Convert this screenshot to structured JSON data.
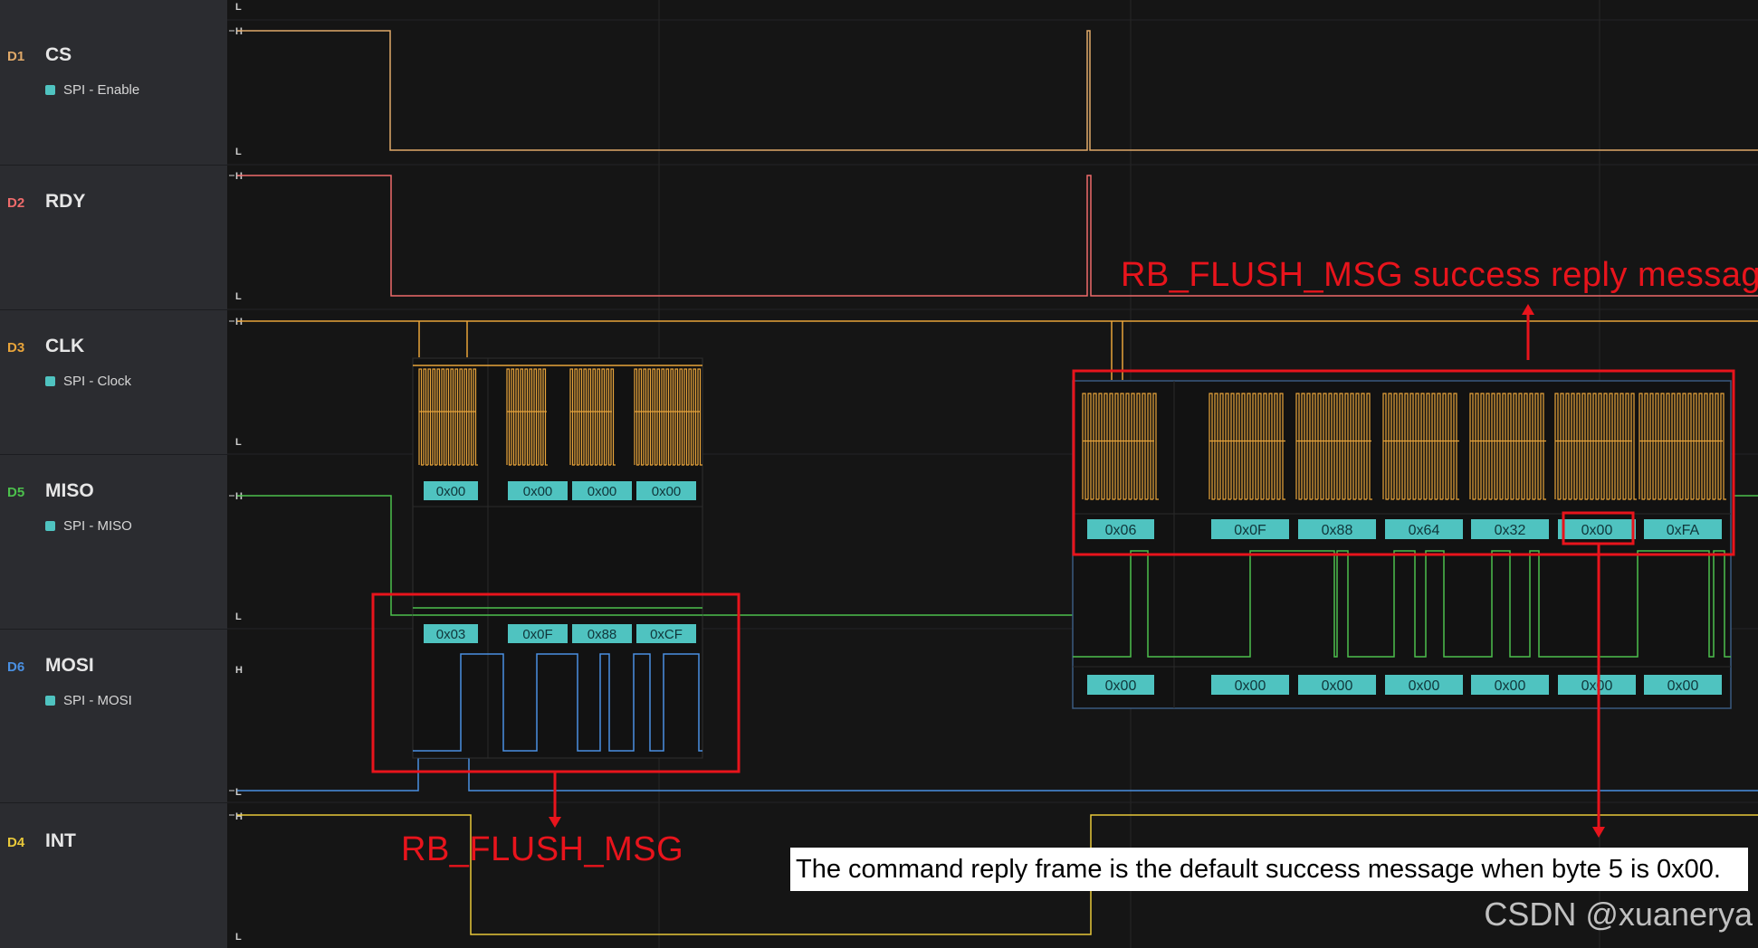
{
  "channels": [
    {
      "id": "D1",
      "name": "CS",
      "sub": "SPI - Enable",
      "color": "#e0a969"
    },
    {
      "id": "D2",
      "name": "RDY",
      "sub": "",
      "color": "#ee6b6b"
    },
    {
      "id": "D3",
      "name": "CLK",
      "sub": "SPI - Clock",
      "color": "#e8a43a"
    },
    {
      "id": "D5",
      "name": "MISO",
      "sub": "SPI - MISO",
      "color": "#4cc04c"
    },
    {
      "id": "D6",
      "name": "MOSI",
      "sub": "SPI - MOSI",
      "color": "#4a90e2"
    },
    {
      "id": "D4",
      "name": "INT",
      "sub": "",
      "color": "#e8c83a"
    }
  ],
  "levels": {
    "high": "H",
    "low": "L"
  },
  "zoom_left": {
    "miso_bytes": [
      "0x00",
      "0x00",
      "0x00",
      "0x00"
    ],
    "mosi_bytes": [
      "0x03",
      "0x0F",
      "0x88",
      "0xCF"
    ]
  },
  "zoom_right": {
    "miso_bytes": [
      "0x06",
      "0x0F",
      "0x88",
      "0x64",
      "0x32",
      "0x00",
      "0xFA"
    ],
    "mosi_bytes": [
      "0x00",
      "0x00",
      "0x00",
      "0x00",
      "0x00",
      "0x00",
      "0x00"
    ]
  },
  "annotations": {
    "left_label": "RB_FLUSH_MSG",
    "right_label": "RB_FLUSH_MSG success reply message",
    "note": "The command reply frame is the default success message when byte 5 is 0x00."
  },
  "watermark": "CSDN @xuanerya",
  "colors": {
    "accent_red": "#e8141c",
    "byte_box": "#4fc3c0",
    "background": "#151515",
    "sidebar": "#2b2c30"
  }
}
